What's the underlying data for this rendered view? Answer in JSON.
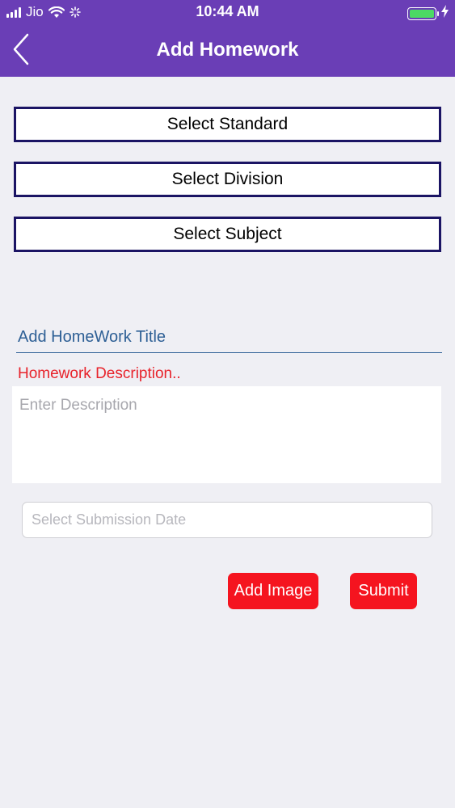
{
  "status_bar": {
    "carrier": "Jio",
    "time": "10:44 AM",
    "battery_color": "#4cd964"
  },
  "header": {
    "title": "Add Homework",
    "back_icon": "chevron-left-icon",
    "background": "#6a3eb6"
  },
  "form": {
    "standard_label": "Select Standard",
    "division_label": "Select Division",
    "subject_label": "Select Subject",
    "title_placeholder": "Add HomeWork Title",
    "description_label": "Homework Description..",
    "description_placeholder": "Enter Description",
    "date_placeholder": "Select Submission Date"
  },
  "actions": {
    "add_image_label": "Add Image",
    "submit_label": "Submit",
    "button_color": "#f5141f"
  }
}
